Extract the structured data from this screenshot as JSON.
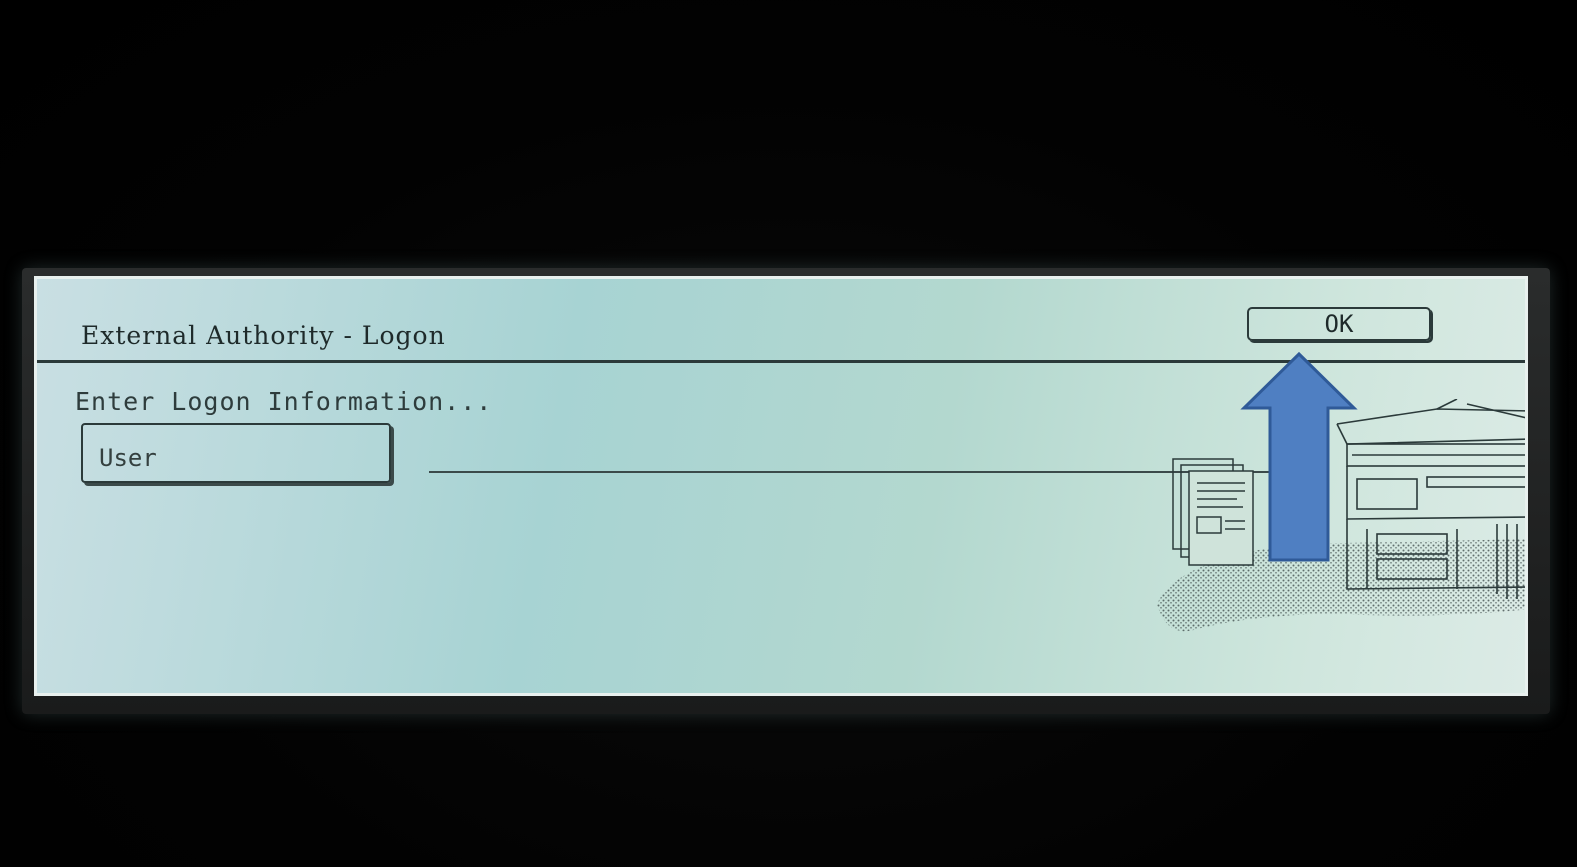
{
  "dialog": {
    "title": "External Authority - Logon",
    "ok_label": "OK",
    "prompt": "Enter Logon Information...",
    "user_label": "User",
    "user_value": ""
  },
  "colors": {
    "screen_bg": "#b3d8cf",
    "text": "#1e2a2a",
    "annotation_arrow": "#4f7fc2"
  },
  "icons": {
    "device": "copier-printer-illustration",
    "annotation": "arrow-up-icon"
  }
}
